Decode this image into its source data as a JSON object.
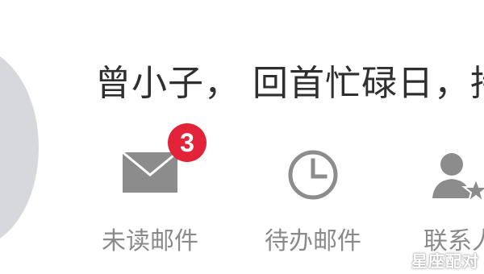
{
  "profile": {
    "greeting": "曾小子， 回首忙碌日，持"
  },
  "shortcuts": [
    {
      "label": "未读邮件",
      "icon": "envelope-icon",
      "badge": "3"
    },
    {
      "label": "待办邮件",
      "icon": "clock-icon"
    },
    {
      "label": "联系人",
      "icon": "contacts-star-icon"
    }
  ],
  "watermark": "星座配对",
  "colors": {
    "badge": "#e2233a",
    "icon": "#8c8c8c",
    "label": "#8a8a8a",
    "avatar": "#d7d8dd"
  }
}
